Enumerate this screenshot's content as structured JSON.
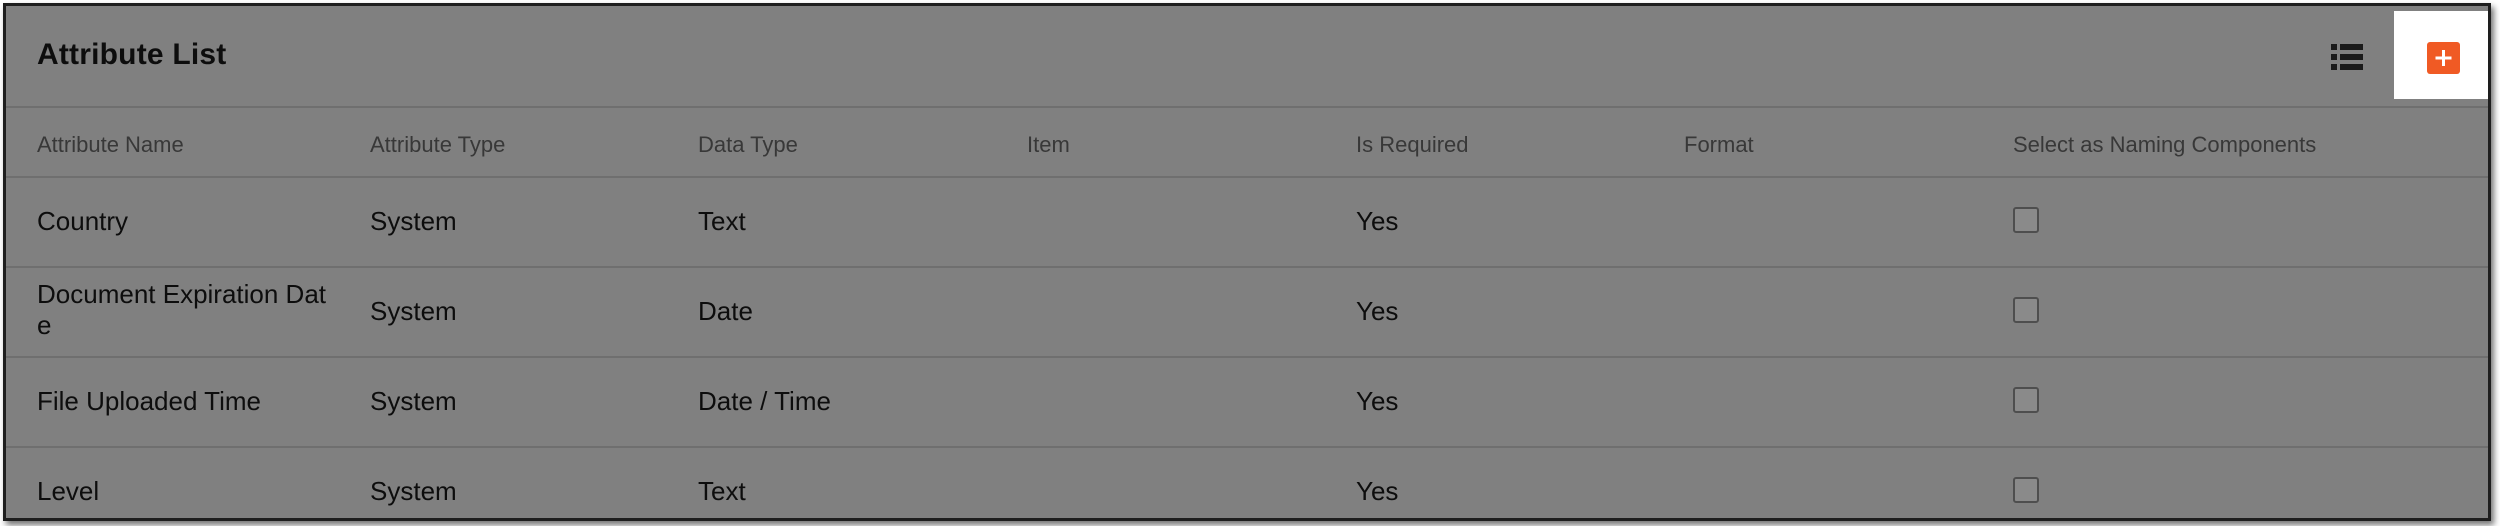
{
  "panel": {
    "title": "Attribute List",
    "list_view_icon": "list-view-icon",
    "add_icon": "plus-icon"
  },
  "table": {
    "columns": [
      "Attribute Name",
      "Attribute Type",
      "Data Type",
      "Item",
      "Is Required",
      "Format",
      "Select as Naming Components"
    ],
    "rows": [
      {
        "name": "Country",
        "attribute_type": "System",
        "data_type": "Text",
        "item": "",
        "is_required": "Yes",
        "format": "",
        "naming_component": false
      },
      {
        "name": "Document Expiration Date",
        "attribute_type": "System",
        "data_type": "Date",
        "item": "",
        "is_required": "Yes",
        "format": "",
        "naming_component": false
      },
      {
        "name": "File Uploaded Time",
        "attribute_type": "System",
        "data_type": "Date / Time",
        "item": "",
        "is_required": "Yes",
        "format": "",
        "naming_component": false
      },
      {
        "name": "Level",
        "attribute_type": "System",
        "data_type": "Text",
        "item": "",
        "is_required": "Yes",
        "format": "",
        "naming_component": false
      }
    ]
  },
  "colors": {
    "accent": "#f05a24",
    "overlay": "#808080",
    "highlight": "#ffffff"
  }
}
